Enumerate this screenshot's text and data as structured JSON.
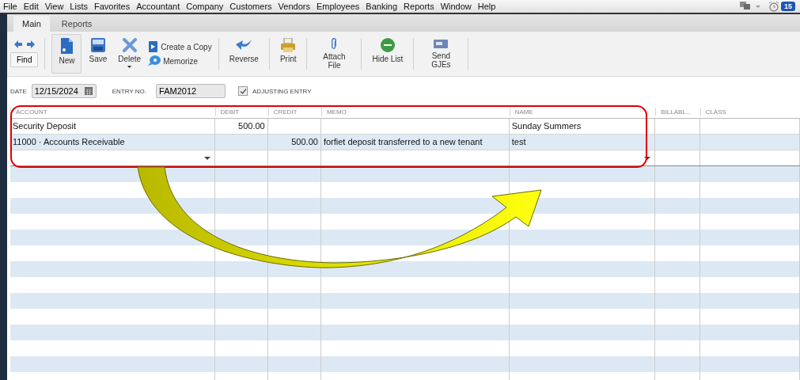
{
  "menu": [
    "File",
    "Edit",
    "View",
    "Lists",
    "Favorites",
    "Accountant",
    "Company",
    "Customers",
    "Vendors",
    "Employees",
    "Banking",
    "Reports",
    "Window",
    "Help"
  ],
  "notifications": {
    "count": "15"
  },
  "tabs": [
    {
      "label": "Main",
      "selected": true
    },
    {
      "label": "Reports",
      "selected": false
    }
  ],
  "toolbar": [
    {
      "kind": "find",
      "label": "Find",
      "selected": false
    },
    {
      "kind": "new",
      "label": "New",
      "selected": true
    },
    {
      "kind": "save",
      "label": "Save",
      "selected": false
    },
    {
      "kind": "delete",
      "label": "Delete",
      "selected": false
    },
    {
      "kind": "pair",
      "items": [
        "Create a Copy",
        "Memorize"
      ]
    },
    {
      "kind": "reverse",
      "label": "Reverse",
      "selected": false
    },
    {
      "kind": "print",
      "label": "Print",
      "selected": false
    },
    {
      "kind": "attach",
      "label": "Attach File",
      "selected": false
    },
    {
      "kind": "hide",
      "label": "Hide List",
      "selected": false
    },
    {
      "kind": "send",
      "label": "Send GJEs",
      "selected": false
    }
  ],
  "form": {
    "date": {
      "label": "DATE",
      "value": "12/15/2024"
    },
    "entry_no": {
      "label": "ENTRY NO.",
      "value": "FAM2012"
    },
    "adjusting": {
      "label": "ADJUSTING ENTRY",
      "checked": true
    }
  },
  "table": {
    "columns": [
      "ACCOUNT",
      "DEBIT",
      "CREDIT",
      "MEMO",
      "NAME",
      "BILLABL...",
      "CLASS"
    ],
    "rows": [
      [
        "Security Deposit",
        "500.00",
        "",
        "",
        "Sunday Summers",
        "",
        ""
      ],
      [
        "11000 · Accounts Receivable",
        "",
        "500.00",
        "forfiet deposit transferred to a new tenant",
        "test",
        "",
        ""
      ]
    ]
  }
}
